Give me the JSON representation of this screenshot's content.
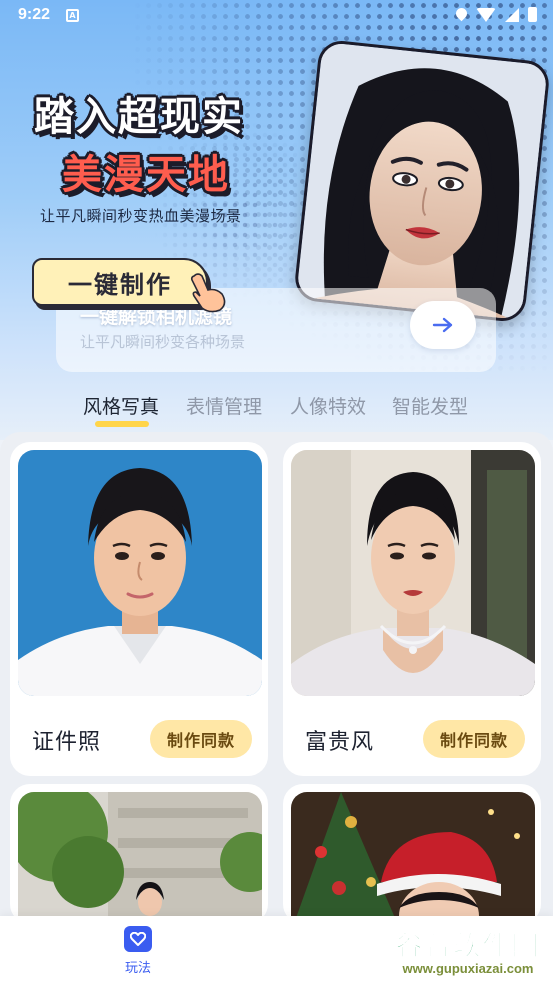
{
  "status_bar": {
    "time": "9:22"
  },
  "hero": {
    "headline_line1": "踏入超现实",
    "headline_line2": "美漫天地",
    "subtitle": "让平凡瞬间秒变热血美漫场景",
    "cta_label": "一键制作",
    "feature_title": "一键解锁相机滤镜",
    "feature_desc": "让平凡瞬间秒变各种场景"
  },
  "tabs": [
    {
      "label": "风格写真",
      "active": true
    },
    {
      "label": "表情管理",
      "active": false
    },
    {
      "label": "人像特效",
      "active": false
    },
    {
      "label": "智能发型",
      "active": false
    }
  ],
  "cards": [
    {
      "name": "证件照",
      "action": "制作同款"
    },
    {
      "name": "富贵风",
      "action": "制作同款"
    }
  ],
  "bottom_nav": {
    "label": "玩法"
  },
  "watermark": {
    "logo": "谷普软件园",
    "url": "www.gupuxiazai.com"
  },
  "colors": {
    "accent": "#3a5cf0",
    "cta_yellow": "#ffe7a6",
    "tab_indicator": "#ffd54a",
    "headline_red": "#ff5d4e"
  }
}
